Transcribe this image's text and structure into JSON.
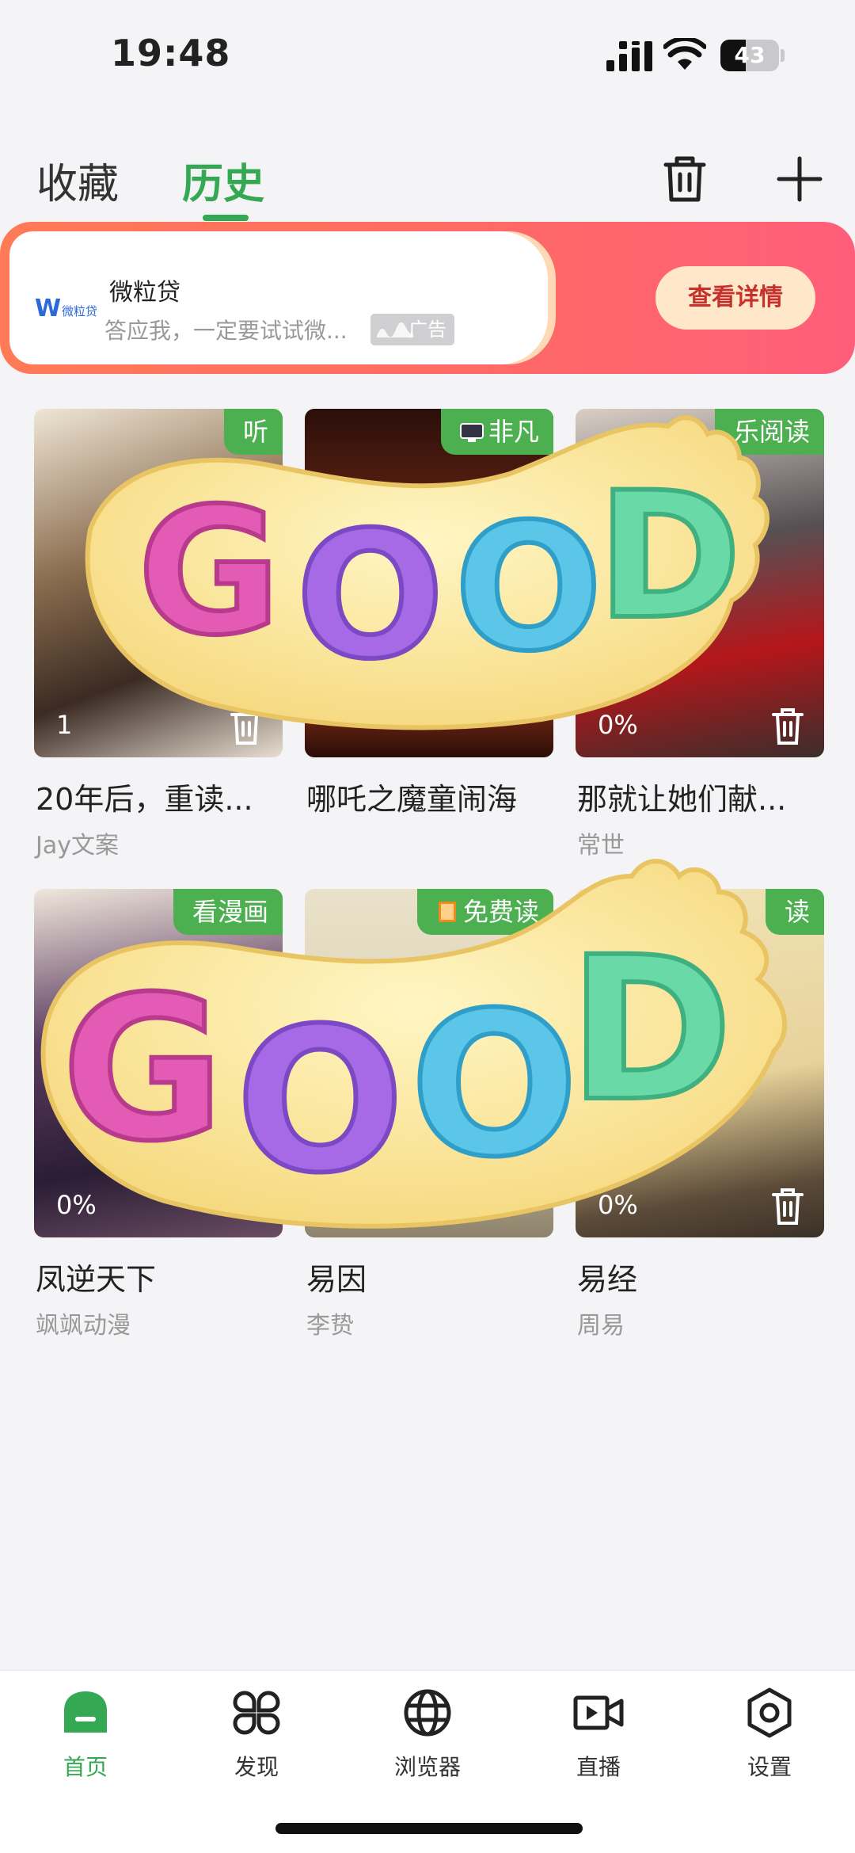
{
  "status_bar": {
    "time": "19:48",
    "battery": "43",
    "battery_level": 0.43
  },
  "header": {
    "tabs": [
      {
        "label": "收藏",
        "active": false
      },
      {
        "label": "历史",
        "active": true
      }
    ],
    "accent_color": "#34a853"
  },
  "ad": {
    "brand": "微粒贷",
    "logo_text": "微粒贷",
    "description": "答应我，一定要试试微...",
    "tag": "广告",
    "cta": "查看详情"
  },
  "history": [
    {
      "title": "20年后，重读...",
      "author": "Jay文案",
      "source": "听",
      "progress": "1"
    },
    {
      "title": "哪吒之魔童闹海",
      "author": "",
      "source": "非凡",
      "progress": ""
    },
    {
      "title": "那就让她们献...",
      "author": "常世",
      "source": "乐阅读",
      "progress": "0%"
    },
    {
      "title": "凤逆天下",
      "author": "飒飒动漫",
      "source": "看漫画",
      "progress": "0%"
    },
    {
      "title": "易因",
      "author": "李贽",
      "source": "免费读",
      "progress": ""
    },
    {
      "title": "易经",
      "author": "周易",
      "source": "读",
      "progress": "0%"
    }
  ],
  "stickers": [
    {
      "text": "GOOD"
    },
    {
      "text": "GOOD"
    }
  ],
  "nav": [
    {
      "label": "首页",
      "icon": "home-icon",
      "active": true
    },
    {
      "label": "发现",
      "icon": "discover-icon",
      "active": false
    },
    {
      "label": "浏览器",
      "icon": "globe-icon",
      "active": false
    },
    {
      "label": "直播",
      "icon": "video-icon",
      "active": false
    },
    {
      "label": "设置",
      "icon": "settings-icon",
      "active": false
    }
  ]
}
